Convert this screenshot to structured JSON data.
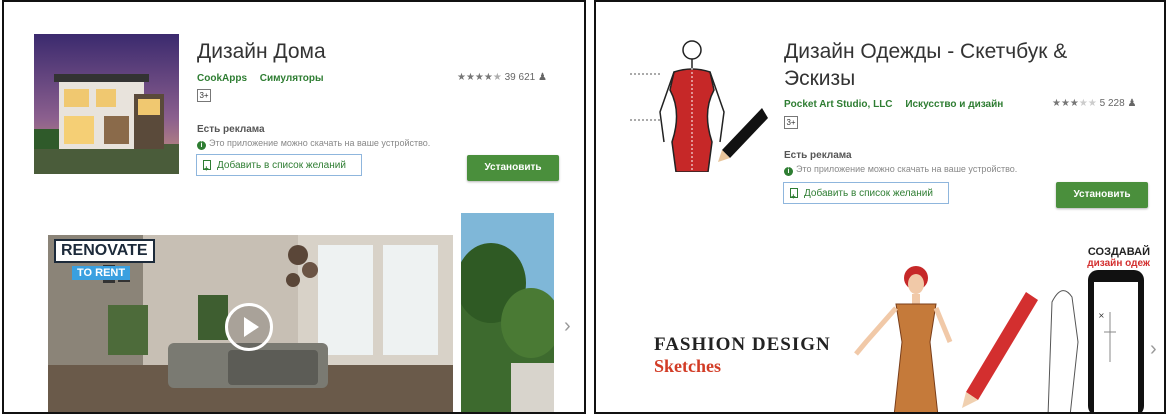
{
  "left": {
    "title": "Дизайн Дома",
    "developer": "CookApps",
    "category": "Симуляторы",
    "rating_stars": "★★★★★",
    "rating_value": 4.5,
    "rating_count": "39 621",
    "age_rating": "3+",
    "ads_label": "Есть реклама",
    "compat_text": "Это приложение можно скачать на ваше устройство.",
    "wishlist_label": "Добавить в список желаний",
    "install_label": "Установить",
    "promo": {
      "line1": "RENOVATE",
      "line2": "TO RENT"
    }
  },
  "right": {
    "title_line1": "Дизайн Одежды - Скетчбук &",
    "title_line2": "Эскизы",
    "developer": "Pocket Art Studio, LLC",
    "category": "Искусство и дизайн",
    "rating_stars": "★★★★★",
    "rating_value": 3,
    "rating_count": "5 228",
    "age_rating": "3+",
    "ads_label": "Есть реклама",
    "compat_text": "Это приложение можно скачать на ваше устройство.",
    "wishlist_label": "Добавить в список желаний",
    "install_label": "Установить",
    "promo": {
      "fashion_line1": "FASHION DESIGN",
      "fashion_line2": "Sketches",
      "cta_line1": "СОЗДАВАЙ",
      "cta_line2": "дизайн одеж"
    }
  },
  "colors": {
    "accent_green": "#4a8f3c",
    "link_green": "#2e7d32",
    "wishlist_border": "#8fb6dd",
    "dress_red": "#c62828"
  },
  "icons": {
    "play": "play-icon",
    "next": "chevron-right-icon",
    "user": "user-icon",
    "wishlist": "bookmark-plus-icon",
    "info": "info-icon"
  }
}
